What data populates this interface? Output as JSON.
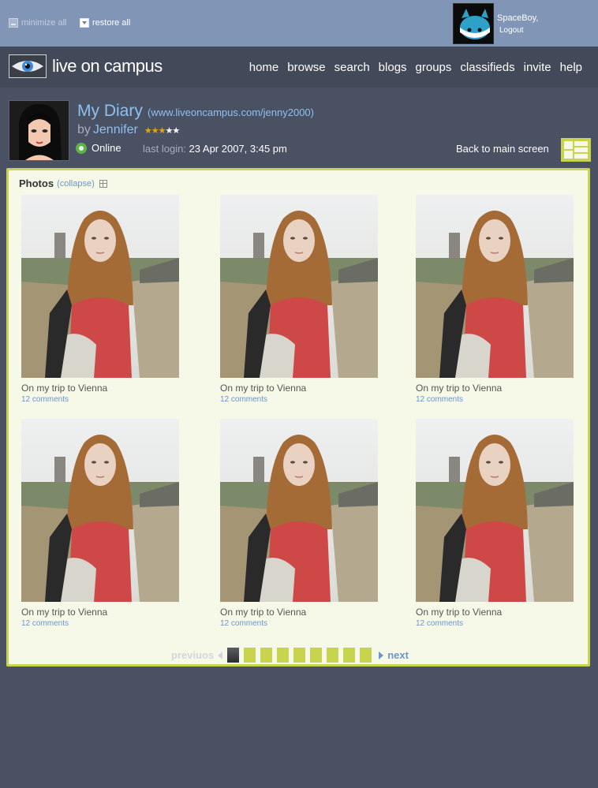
{
  "topbar": {
    "minimize_label": "minimize all",
    "restore_label": "restore all",
    "username": "SpaceBoy,",
    "logout_label": "Logout"
  },
  "header": {
    "logo_text": "live on campus",
    "nav": [
      "home",
      "browse",
      "search",
      "blogs",
      "groups",
      "classifieds",
      "invite",
      "help"
    ]
  },
  "profile": {
    "diary_title": "My Diary",
    "diary_url": "(www.liveoncampus.com/jenny2000)",
    "by_label": "by",
    "author": "Jennifer",
    "rating": 3,
    "rating_max": 5,
    "status": "Online",
    "last_login_label": "last login:",
    "last_login_value": "23 Apr 2007, 3:45 pm",
    "back_label": "Back to main screen"
  },
  "photos_panel": {
    "title": "Photos",
    "collapse_label": "(collapse)",
    "items": [
      {
        "caption": "On my trip to Vienna",
        "comments": "12 comments"
      },
      {
        "caption": "On my trip to Vienna",
        "comments": "12 comments"
      },
      {
        "caption": "On my trip to Vienna",
        "comments": "12 comments"
      },
      {
        "caption": "On my trip to Vienna",
        "comments": "12 comments"
      },
      {
        "caption": "On my trip to Vienna",
        "comments": "12 comments"
      },
      {
        "caption": "On my trip to Vienna",
        "comments": "12 comments"
      }
    ]
  },
  "pagination": {
    "prev_label": "previuos",
    "next_label": "next",
    "page_count": 9,
    "active_page": 1
  },
  "colors": {
    "accent": "#c8d44e",
    "link": "#8ec0f0",
    "background": "#4a5163",
    "topbar": "#8196b6",
    "panel": "#f6f8e8"
  }
}
